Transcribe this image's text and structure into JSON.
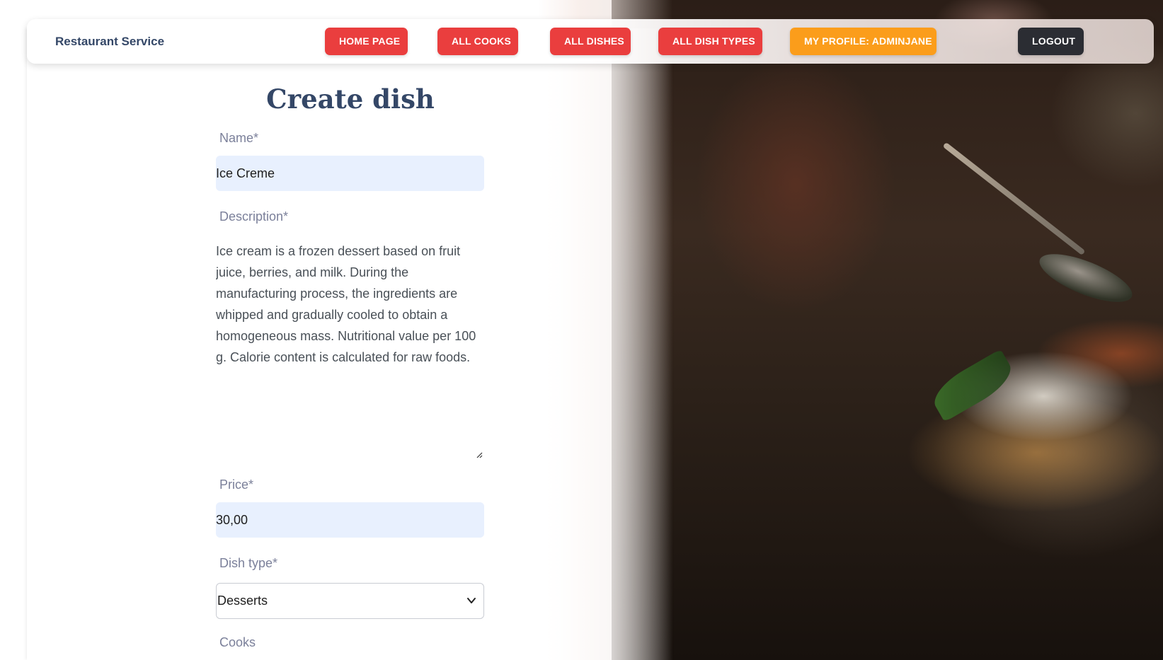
{
  "navbar": {
    "brand": "Restaurant Service",
    "buttons": [
      {
        "label": "HOME PAGE",
        "variant": "red"
      },
      {
        "label": "ALL COOKS",
        "variant": "red"
      },
      {
        "label": "ALL DISHES",
        "variant": "red"
      },
      {
        "label": "ALL DISH TYPES",
        "variant": "red"
      },
      {
        "label": "MY PROFILE: ADMINJANE",
        "variant": "orange"
      },
      {
        "label": "LOGOUT",
        "variant": "dark"
      }
    ]
  },
  "form": {
    "title": "Create dish",
    "name": {
      "label": "Name*",
      "value": "Ice Creme"
    },
    "description": {
      "label": "Description*",
      "value": "Ice cream is a frozen dessert based on fruit juice, berries, and milk. During the manufacturing process, the ingredients are whipped and gradually cooled to obtain a homogeneous mass. Nutritional value per 100 g. Calorie content is calculated for raw foods."
    },
    "price": {
      "label": "Price*",
      "value": "30,00"
    },
    "dish_type": {
      "label": "Dish type*",
      "selected": "Desserts"
    },
    "cooks": {
      "label": "Cooks"
    }
  },
  "colors": {
    "primary_red": "#ea3e3e",
    "profile_orange": "#fb9d1b",
    "logout_dark": "#2b2d33",
    "heading": "#344767",
    "label": "#7b809a",
    "input_bg": "#e8f0fe"
  }
}
